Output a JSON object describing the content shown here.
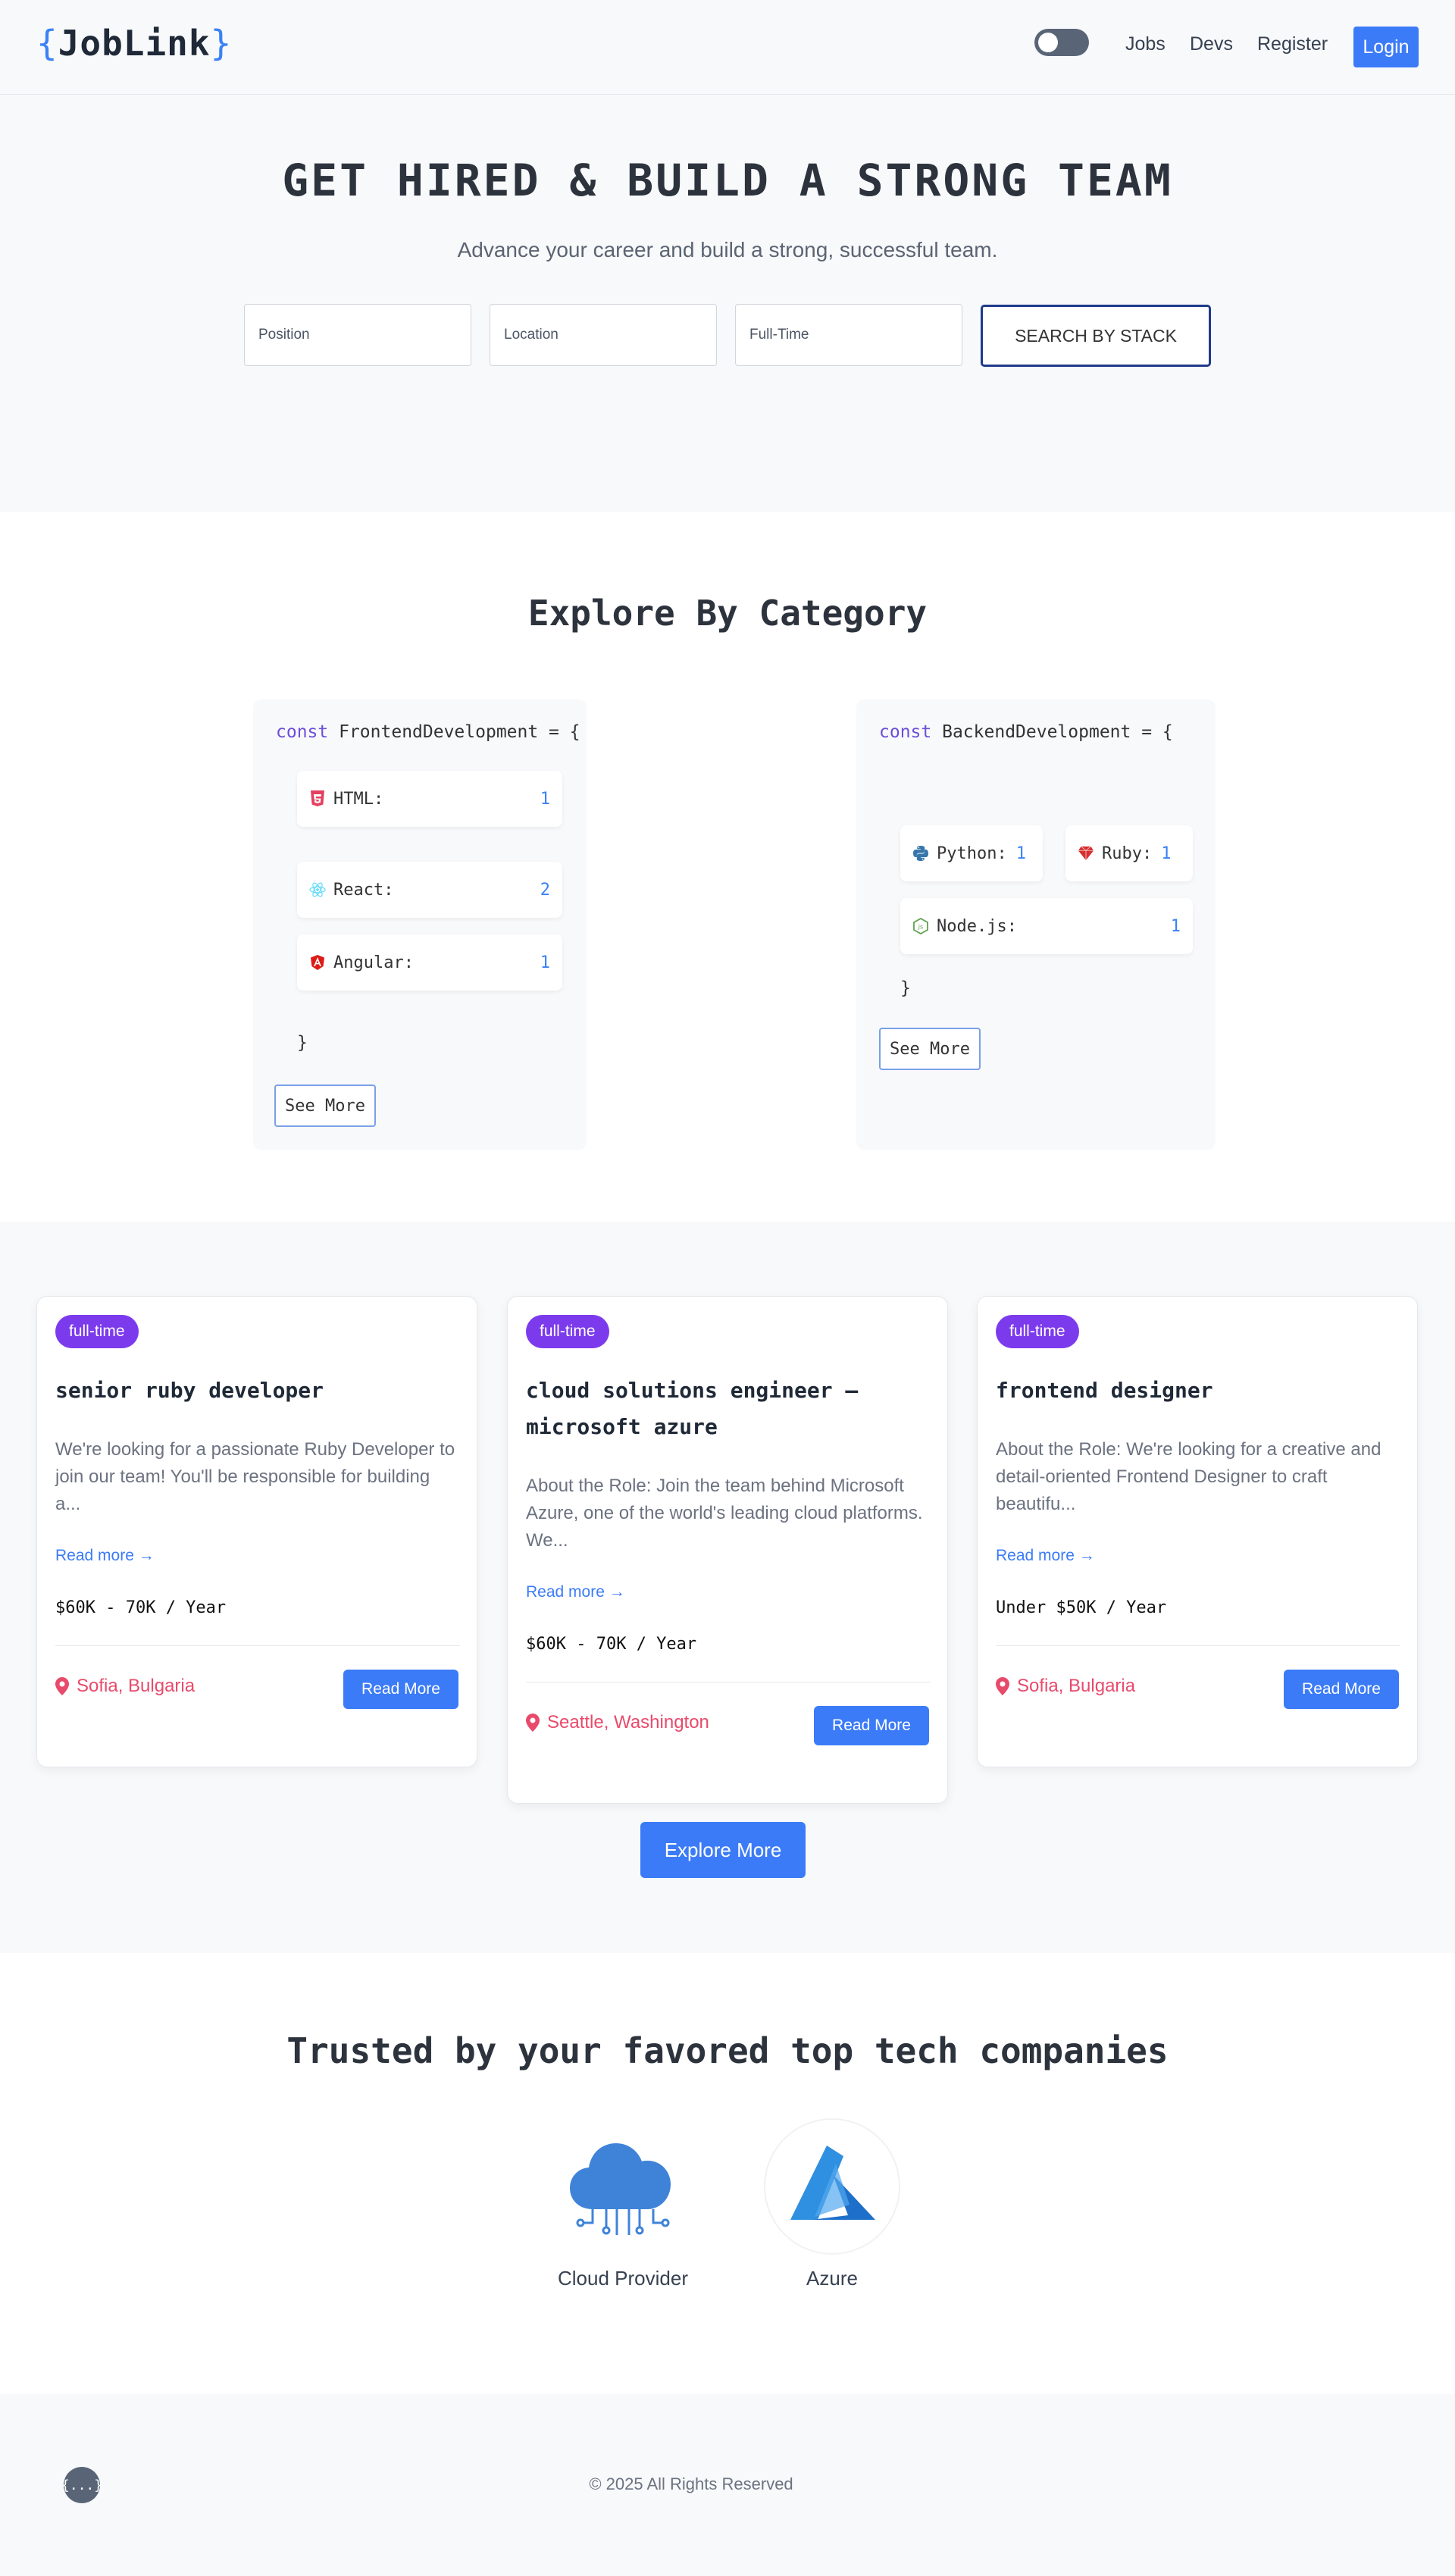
{
  "header": {
    "logo_open": "{",
    "logo_text": "JobLink",
    "logo_close": "}",
    "nav": [
      "Jobs",
      "Devs",
      "Register"
    ],
    "login_label": "Login"
  },
  "hero": {
    "title": "GET HIRED & BUILD A STRONG TEAM",
    "subtitle": "Advance your career and build a strong, successful team.",
    "position_placeholder": "Position",
    "location_placeholder": "Location",
    "type_placeholder": "Full-Time",
    "search_label": "SEARCH BY STACK"
  },
  "categories": {
    "title": "Explore By Category",
    "frontend": {
      "keyword": "const",
      "name": "FrontendDevelopment = {",
      "items": [
        {
          "label": "HTML:",
          "count": "1",
          "icon": "html5-icon"
        },
        {
          "label": "React:",
          "count": "2",
          "icon": "react-icon"
        },
        {
          "label": "Angular:",
          "count": "1",
          "icon": "angular-icon"
        }
      ],
      "close": "}",
      "see_more": "See More"
    },
    "backend": {
      "keyword": "const",
      "name": "BackendDevelopment = {",
      "items": [
        {
          "label": "Python:",
          "count": "1",
          "icon": "python-icon"
        },
        {
          "label": "Ruby:",
          "count": "1",
          "icon": "ruby-icon"
        },
        {
          "label": "Node.js:",
          "count": "1",
          "icon": "nodejs-icon"
        }
      ],
      "close": "}",
      "see_more": "See More"
    }
  },
  "jobs": {
    "cards": [
      {
        "badge": "full-time",
        "title": "senior ruby developer",
        "description": "We're looking for a passionate Ruby Developer to join our team! You'll be responsible for building a...",
        "read_more_link": "Read more →",
        "salary": "$60K - 70K / Year",
        "location": "Sofia, Bulgaria",
        "button": "Read More"
      },
      {
        "badge": "full-time",
        "title": "cloud solutions engineer – microsoft azure",
        "description": "About the Role: Join the team behind Microsoft Azure, one of the world's leading cloud platforms. We...",
        "read_more_link": "Read more →",
        "salary": "$60K - 70K / Year",
        "location": "Seattle, Washington",
        "button": "Read More"
      },
      {
        "badge": "full-time",
        "title": "frontend designer",
        "description": "About the Role: We're looking for a creative and detail-oriented Frontend Designer to craft beautifu...",
        "read_more_link": "Read more →",
        "salary": "Under $50K / Year",
        "location": "Sofia, Bulgaria",
        "button": "Read More"
      }
    ],
    "explore_more": "Explore More"
  },
  "trusted": {
    "title": "Trusted by your favored top tech companies",
    "companies": [
      {
        "name": "Cloud Provider",
        "icon": "cloud-icon"
      },
      {
        "name": "Azure",
        "icon": "azure-icon"
      }
    ]
  },
  "footer": {
    "logo": "{...}",
    "copyright": "© 2025 All Rights Reserved"
  },
  "colors": {
    "accent": "#3b7bf7",
    "badge": "#7c3aed",
    "location": "#e84a6b",
    "keyword": "#6d4ed8"
  }
}
